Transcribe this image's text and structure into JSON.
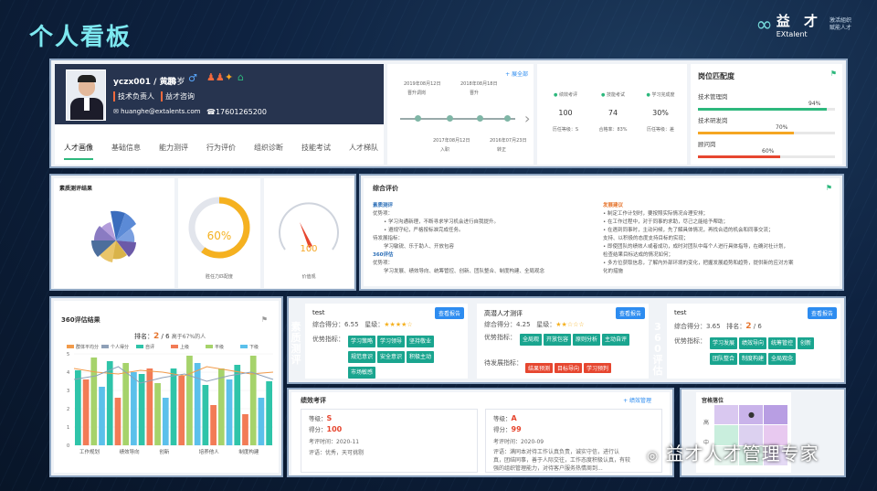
{
  "page": {
    "title": "个人看板"
  },
  "logo": {
    "cn": "益 才",
    "en": "EXtalent",
    "slogan1": "激活組织",
    "slogan2": "赋能人才"
  },
  "profile": {
    "name": "yczx001 / 黄鹏",
    "age": "28岁",
    "role": "技术负责人",
    "company": "益才咨询",
    "email": "huanghe@extalents.com",
    "phone": "17601265200"
  },
  "tabs": [
    "人才画像",
    "基础信息",
    "能力测评",
    "行为评价",
    "组织诊断",
    "技能考试",
    "人才梯队"
  ],
  "timeline": {
    "more": "+ 展全部",
    "events": [
      "2019年08月12日",
      "2018年08月18日",
      "2017年08月12日",
      "2016年07月23日"
    ],
    "labels": [
      "晋升调岗",
      "晋升",
      "入职",
      "转正"
    ]
  },
  "stats": [
    {
      "icon": "trophy-icon",
      "label": "绩效考评",
      "value": "100",
      "sub": "历任等级：S"
    },
    {
      "icon": "chart-icon",
      "label": "技能考试",
      "value": "74",
      "sub": "合格率：83%"
    },
    {
      "icon": "book-icon",
      "label": "学习完成度",
      "value": "30%",
      "sub": "历任等级：差"
    }
  ],
  "match": {
    "title": "岗位匹配度",
    "items": [
      {
        "label": "技术管理岗",
        "value": "94%",
        "pct": 0.94,
        "color": "#2db87d"
      },
      {
        "label": "技术研发岗",
        "value": "70%",
        "pct": 0.7,
        "color": "#f5a623"
      },
      {
        "label": "顾问岗",
        "value": "60%",
        "pct": 0.6,
        "color": "#e6462f"
      }
    ]
  },
  "radar": {
    "title": "素质测评结果"
  },
  "gauge1": {
    "value": "60%",
    "pct": 0.6,
    "label": "胜任力匹配度"
  },
  "gauge2": {
    "value": "100",
    "pct": 0.62,
    "label": "价值观"
  },
  "eval": {
    "title": "综合评价",
    "left_title": "素质测评",
    "strength": "优势项：",
    "s1": "学习沟通新理，不断寻求学习机会进行自我提升。",
    "s2": "遵规守纪，严格按标准完成任务。",
    "weak": "待发展指标：",
    "weak_items": "学习敏锐、乐于助人、开放包容",
    "sec2": "360评估",
    "strength2": "优势项：",
    "s2items": "学习发展、绩效导向、统筹管控、创新、团队整合、制度构建、全局观念",
    "right_title": "发展建议",
    "r1": "制定工作计划时，要按照实际情况合理安排；",
    "r2": "在工作过程中，对于同事的求助，尽己之能给予帮助；",
    "r3": "在遇到同事时，主动问候，先了解具体情况，再找合适的机会和同事交流；",
    "r4": "支持、以积极的态度支持目标的实现；",
    "r5": "即使团队的绩效人或者成功，成时对团队中每个人进行具体指导，在确对社计划，",
    "r6": "检查结果目标达成的情况如何；",
    "r7": "多方位获取信息，了解内外部环境的变化，把握发展趋势和趋势，提供新的应对方案",
    "r8": "化的措施"
  },
  "s360": {
    "title": "360评估结果",
    "rank_label": "排名：",
    "rank": "2",
    "total": "/ 6",
    "rank_sub": "高于67%的人",
    "legend": [
      "群体平均分",
      "个人得分",
      "自评",
      "上级",
      "平级",
      "下级"
    ],
    "colors": [
      "#f29b4b",
      "#8fa0b8",
      "#2fc4a9",
      "#f27b56",
      "#a6d36b",
      "#5bc0eb"
    ],
    "categories": [
      "工作规划",
      "绩效导向",
      "创新",
      "培养他人",
      "制度构建"
    ]
  },
  "labels": {
    "suzhi": "素质测评",
    "p360": "360评估"
  },
  "test": [
    {
      "name": "test",
      "score_label": "综合得分：",
      "score": "6.55",
      "star_label": "星级：",
      "stars": "★★★★☆",
      "btn": "查看报告",
      "adv_label": "优势指标：",
      "tags": [
        "学习策略",
        "学习领导",
        "坚持敬业",
        "规范意识",
        "安全意识",
        "积极主动",
        "市场敏感"
      ]
    },
    {
      "name": "高潜人才测评",
      "score_label": "综合得分：",
      "score": "4.25",
      "star_label": "星级：",
      "stars": "★★☆☆☆",
      "btn": "查看报告",
      "adv_label": "优势指标：",
      "tags": [
        "全局观",
        "开放包容",
        "原则分析",
        "主动自评"
      ],
      "weak_label": "待发展指标：",
      "weak_tags": [
        "结果预测",
        "目标导向",
        "学习预判"
      ]
    }
  ],
  "r360": {
    "name": "test",
    "score_label": "综合得分：",
    "score": "3.65",
    "rank_label": "排名：",
    "rank": "2",
    "total": "/ 6",
    "btn": "查看报告",
    "adv_label": "优势指标：",
    "tags": [
      "学习发展",
      "绩效导向",
      "统筹管控",
      "创新",
      "团队整合",
      "制度构建",
      "全局观念"
    ]
  },
  "perf": {
    "title": "绩效考评",
    "link": "+ 绩效管理",
    "cards": [
      {
        "grade_label": "等级：",
        "grade": "S",
        "score_label": "得分：",
        "score": "100",
        "time_label": "考评时间：",
        "time": "2020-11",
        "comment_label": "评语：",
        "comment": "优秀，天可挑剔"
      },
      {
        "grade_label": "等级：",
        "grade": "A",
        "score_label": "得分：",
        "score": "99",
        "time_label": "考评时间：",
        "time": "2020-09",
        "comment_label": "评语：",
        "comment": "满同本对待工作认真负责，诚实守信，进行认真，团结同事，善于人际交往，工作态度积极认真，有较强的组织管理能力，对待客户服务热情周到..."
      }
    ]
  },
  "grid9": {
    "title": "宫格落位",
    "rows": [
      "高",
      "中"
    ]
  },
  "watermark": "益才人才管理专家"
}
